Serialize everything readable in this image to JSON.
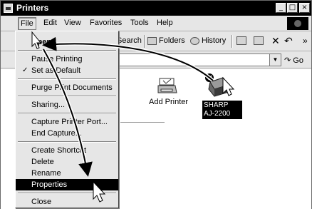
{
  "window": {
    "title": "Printers",
    "minimize_glyph": "_",
    "maximize_glyph": "□",
    "close_glyph": "×"
  },
  "menubar": {
    "items": [
      {
        "label": "File"
      },
      {
        "label": "Edit"
      },
      {
        "label": "View"
      },
      {
        "label": "Favorites"
      },
      {
        "label": "Tools"
      },
      {
        "label": "Help"
      }
    ]
  },
  "toolbar": {
    "search_label": "Search",
    "folders_label": "Folders",
    "history_label": "History",
    "delete_glyph": "✕",
    "undo_glyph": "↶",
    "more_glyph": "»"
  },
  "addressbar": {
    "go_label": "Go",
    "go_arrow": "↷"
  },
  "content": {
    "items": [
      {
        "label": "Add Printer",
        "icon": "add-printer-icon"
      },
      {
        "label_line1": "SHARP",
        "label_line2": "AJ-2200",
        "icon": "printer-icon"
      }
    ]
  },
  "file_menu": {
    "items": [
      {
        "label": "Open",
        "bold": true
      },
      {
        "label": "Pause Printing"
      },
      {
        "label": "Set as Default",
        "checked": true,
        "check_glyph": "✓"
      },
      {
        "label": "Purge Print Documents"
      },
      {
        "label": "Sharing..."
      },
      {
        "label": "Capture Printer Port..."
      },
      {
        "label": "End Capture..."
      },
      {
        "label": "Create Shortcut"
      },
      {
        "label": "Delete"
      },
      {
        "label": "Rename"
      },
      {
        "label": "Properties",
        "selected": true
      },
      {
        "label": "Close"
      }
    ]
  },
  "colors": {
    "titlebar": "#000000",
    "selection": "#000000",
    "chrome": "#e6e6e6"
  }
}
